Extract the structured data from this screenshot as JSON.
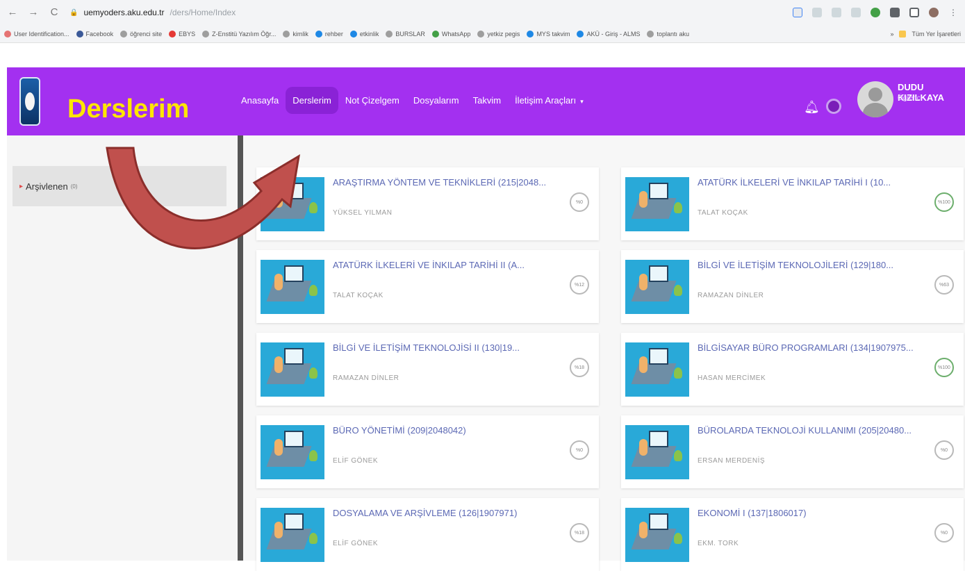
{
  "browser": {
    "back": "←",
    "forward": "→",
    "reload": "C",
    "url_host": "uemyoders.aku.edu.tr",
    "url_path": "/ders/Home/Index"
  },
  "bookmarks": [
    {
      "label": "User Identification...",
      "color": "#e57373"
    },
    {
      "label": "Facebook",
      "color": "#3b5998"
    },
    {
      "label": "öğrenci site",
      "color": "#9e9e9e"
    },
    {
      "label": "EBYS",
      "color": "#e53935"
    },
    {
      "label": "Z-Enstitü Yazılım Öğr...",
      "color": "#9e9e9e"
    },
    {
      "label": "kimlik",
      "color": "#9e9e9e"
    },
    {
      "label": "rehber",
      "color": "#1e88e5"
    },
    {
      "label": "etkinlik",
      "color": "#1e88e5"
    },
    {
      "label": "BURSLAR",
      "color": "#9e9e9e"
    },
    {
      "label": "WhatsApp",
      "color": "#43a047"
    },
    {
      "label": "yetkiz pegis",
      "color": "#9e9e9e"
    },
    {
      "label": "MYS takvim",
      "color": "#1e88e5"
    },
    {
      "label": "AKÜ - Giriş - ALMS",
      "color": "#1e88e5"
    },
    {
      "label": "toplantı aku",
      "color": "#9e9e9e"
    }
  ],
  "bookmarks_all": "Tüm Yer İşaretleri",
  "header": {
    "overlay_title": "Derslerim",
    "menu": [
      {
        "label": "Anasayfa",
        "active": false
      },
      {
        "label": "Derslerim",
        "active": true
      },
      {
        "label": "Not Çizelgem",
        "active": false
      },
      {
        "label": "Dosyalarım",
        "active": false
      },
      {
        "label": "Takvim",
        "active": false
      },
      {
        "label": "İletişim Araçları",
        "active": false,
        "dropdown": true
      }
    ],
    "user_name": "DUDU KIZILKAYA",
    "user_role": "Öğrenci"
  },
  "sidebar": {
    "item_label": "Arşivlenen",
    "item_count": "(0)"
  },
  "courses": [
    {
      "title": "ARAŞTIRMA YÖNTEM VE TEKNİKLERİ (215|2048...",
      "teacher": "YÜKSEL YILMAN",
      "progress": "%0"
    },
    {
      "title": "ATATÜRK İLKELERİ VE İNKILAP TARİHİ I (10...",
      "teacher": "TALAT KOÇAK",
      "progress": "%100"
    },
    {
      "title": "ATATÜRK İLKELERİ VE İNKILAP TARİHİ II (A...",
      "teacher": "TALAT KOÇAK",
      "progress": "%12"
    },
    {
      "title": "BİLGİ VE İLETİŞİM TEKNOLOJİLERİ (129|180...",
      "teacher": "RAMAZAN DİNLER",
      "progress": "%63"
    },
    {
      "title": "BİLGİ VE İLETİŞİM TEKNOLOJİSİ II (130|19...",
      "teacher": "RAMAZAN DİNLER",
      "progress": "%18"
    },
    {
      "title": "BİLGİSAYAR BÜRO PROGRAMLARI (134|1907975...",
      "teacher": "HASAN MERCİMEK",
      "progress": "%100"
    },
    {
      "title": "BÜRO YÖNETİMİ (209|2048042)",
      "teacher": "ELİF GÖNEK",
      "progress": "%0"
    },
    {
      "title": "BÜROLARDA TEKNOLOJİ KULLANIMI (205|20480...",
      "teacher": "ERSAN MERDENİŞ",
      "progress": "%0"
    },
    {
      "title": "DOSYALAMA VE ARŞİVLEME (126|1907971)",
      "teacher": "ELİF GÖNEK",
      "progress": "%18"
    },
    {
      "title": "EKONOMİ I (137|1806017)",
      "teacher": "EKM. TORK",
      "progress": "%0"
    }
  ]
}
